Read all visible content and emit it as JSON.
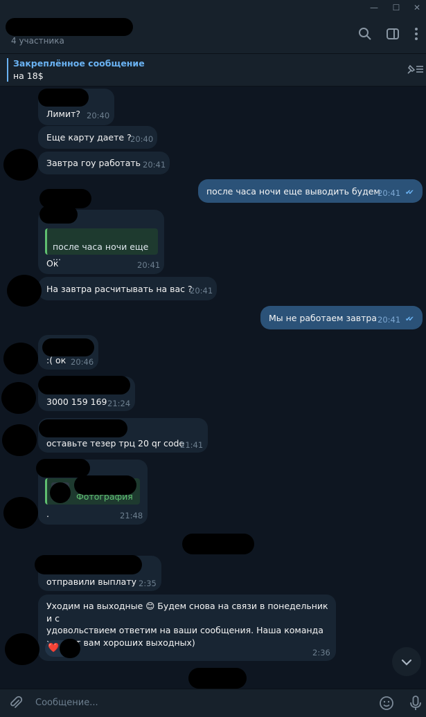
{
  "header": {
    "subtitle": "4 участника"
  },
  "pinned": {
    "title": "Закреплённое сообщение",
    "text": "на 18$"
  },
  "messages": [
    {
      "text": "Лимит?",
      "time": "20:40"
    },
    {
      "text": "Еще карту даете ?",
      "time": "20:40"
    },
    {
      "text": "Завтра гоу работать",
      "time": "20:41"
    },
    {
      "text": "после часа ночи еще выводить будем",
      "time": "20:41"
    },
    {
      "reply": "после часа ночи еще ...",
      "text": "Ок",
      "time": "20:41"
    },
    {
      "text": "На завтра расчитывать на вас ?",
      "time": "20:41"
    },
    {
      "text": "Мы не работаем завтра",
      "time": "20:41"
    },
    {
      "text": ":( ок",
      "time": "20:46"
    },
    {
      "text": "3000 159 169",
      "time": "21:24"
    },
    {
      "text": "оставьте тезер трц 20 qr code",
      "time": "21:41"
    },
    {
      "reply": "Фотография",
      "text": ".",
      "time": "21:48"
    },
    {
      "text": "отправили выплату",
      "time": "2:35"
    },
    {
      "text_lines": [
        "Уходим на выходные 😊 Будем снова на связи в понедельник и с",
        "удовольствием ответим на ваши сообщения. Наша команда",
        "желает вам хороших выходных)"
      ],
      "reaction": "❤️",
      "time": "2:36"
    }
  ],
  "composer": {
    "placeholder": "Сообщение..."
  },
  "icons": [
    "minimize-icon",
    "maximize-icon",
    "close-icon",
    "search-icon",
    "sidebar-icon",
    "more-icon",
    "pin-list-icon",
    "attach-icon",
    "emoji-icon",
    "microphone-icon",
    "scroll-down-icon",
    "read-check-icon"
  ],
  "colors": {
    "background": "#0e1621",
    "incoming": "#182533",
    "outgoing": "#2b5278",
    "accent": "#6ab2f2"
  }
}
